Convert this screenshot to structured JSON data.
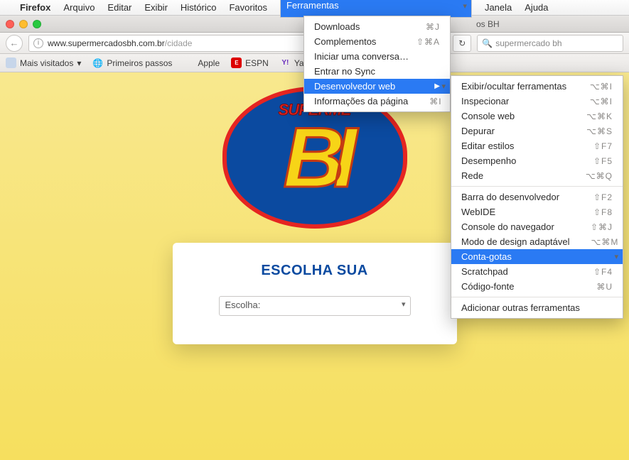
{
  "menubar": {
    "app": "Firefox",
    "items": [
      "Arquivo",
      "Editar",
      "Exibir",
      "Histórico",
      "Favoritos",
      "Ferramentas",
      "Janela",
      "Ajuda"
    ],
    "selected_index": 5
  },
  "window": {
    "tab_tail": "os BH"
  },
  "toolbar": {
    "url_host": "www.supermercadosbh.com.br",
    "url_path": "/cidade",
    "search_value": "supermercado bh"
  },
  "bookmarks": [
    {
      "label": "Mais visitados",
      "icon": "grid",
      "chevron": true
    },
    {
      "label": "Primeiros passos",
      "icon": "globe"
    },
    {
      "label": "Apple",
      "icon": "apple"
    },
    {
      "label": "ESPN",
      "icon": "espn",
      "icon_text": "E"
    },
    {
      "label": "Yahoo",
      "icon": "yahoo",
      "icon_text": "Y!"
    }
  ],
  "page": {
    "logo_top": "SUPERME",
    "logo_main": "BI",
    "card_heading": "ESCOLHA SUA",
    "select_placeholder": "Escolha:"
  },
  "menu1": {
    "items": [
      {
        "label": "Downloads",
        "sc": "⌘J"
      },
      {
        "label": "Complementos",
        "sc": "⇧⌘A"
      },
      {
        "label": "Iniciar uma conversa…"
      },
      {
        "label": "Entrar no Sync"
      }
    ],
    "highlight": {
      "label": "Desenvolvedor web",
      "arrow": "▶"
    },
    "after": [
      {
        "label": "Informações da página",
        "sc": "⌘I"
      }
    ]
  },
  "menu2": {
    "g1": [
      {
        "label": "Exibir/ocultar ferramentas",
        "sc": "⌥⌘I"
      },
      {
        "label": "Inspecionar",
        "sc": "⌥⌘I"
      },
      {
        "label": "Console web",
        "sc": "⌥⌘K"
      },
      {
        "label": "Depurar",
        "sc": "⌥⌘S"
      },
      {
        "label": "Editar estilos",
        "sc": "⇧F7"
      },
      {
        "label": "Desempenho",
        "sc": "⇧F5"
      },
      {
        "label": "Rede",
        "sc": "⌥⌘Q"
      }
    ],
    "g2": [
      {
        "label": "Barra do desenvolvedor",
        "sc": "⇧F2"
      },
      {
        "label": "WebIDE",
        "sc": "⇧F8"
      },
      {
        "label": "Console do navegador",
        "sc": "⇧⌘J"
      },
      {
        "label": "Modo de design adaptável",
        "sc": "⌥⌘M"
      }
    ],
    "highlight": {
      "label": "Conta-gotas"
    },
    "g3": [
      {
        "label": "Scratchpad",
        "sc": "⇧F4"
      },
      {
        "label": "Código-fonte",
        "sc": "⌘U"
      }
    ],
    "g4": [
      {
        "label": "Adicionar outras ferramentas"
      }
    ]
  }
}
